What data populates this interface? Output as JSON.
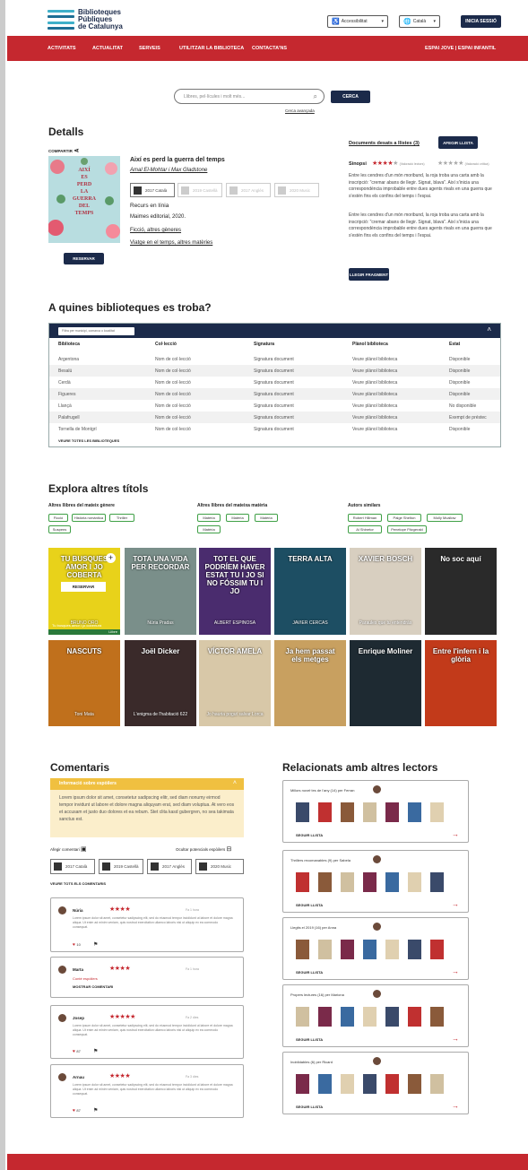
{
  "header": {
    "logo": [
      "Biblioteques",
      "Públiques",
      "de Catalunya"
    ],
    "accessibility": "Accessibilitat",
    "language": "Català",
    "login": "INICIA SESSIÓ",
    "nav": [
      "ACTIVITATS",
      "ACTUALITAT",
      "SERVEIS",
      "UTILITZAR LA BIBLIOTECA",
      "CONTACTA'NS"
    ],
    "nav_right": "ESPAI JOVE | ESPAI INFANTIL"
  },
  "search": {
    "placeholder": "Llibres, pel·lícules i molt més...",
    "button": "CERCA",
    "advanced": "Cerca avançada"
  },
  "details": {
    "heading": "Detalls",
    "share": "COMPARTIR",
    "title": "Així es perd la guerra del temps",
    "authors": "Amal El-Mohtar i Max Gladstone",
    "formats": [
      {
        "year": "2017",
        "lang": "Català"
      },
      {
        "year": "2019",
        "lang": "Castellà"
      },
      {
        "year": "2017",
        "lang": "Anglès"
      },
      {
        "year": "2020",
        "lang": "Music"
      }
    ],
    "online": "Recurs en línia",
    "publisher": "Maimes editorial, 2020.",
    "genre": "Ficció, altres gèneres",
    "subject": "Viatge en el temps, altres matèries",
    "reserve": "RESERVAR",
    "saved_docs": "Documents desats a llistes (3)",
    "add_list": "AFEGIR LLISTA",
    "synopsis_label": "Sinopsi",
    "rating_label": "(Valoració lectors)",
    "rating_label_2": "(Valoració crítica)",
    "synopsis_p1": "Entre les cendres d'un món moribund, la roja troba una carta amb la inscripció: \"cremar abans de llegir. Signat, blava\". Així s'inicia una correspondència improbable entre dues agents rivals en una guerra que s'estén fins els confins del temps i l'espai.",
    "synopsis_p2": "Entre les cendres d'un món moribund, la roja troba una carta amb la inscripció: \"cremar abans de llegir. Signat, blava\". Així s'inicia una correspondència improbable entre dues agents rivals en una guerra que s'estén fins els confins del temps i l'espai.",
    "fragment": "LLEGIR FRAGMENT",
    "cover_lines": [
      "AIXÍ",
      "ES",
      "PERD",
      "LA",
      "GUERRA",
      "DEL",
      "TEMPS"
    ]
  },
  "libraries": {
    "heading": "A quines biblioteques es troba?",
    "filter_placeholder": "Filtra per municipi, comarca o localitat",
    "columns": [
      "Biblioteca",
      "Col·lecció",
      "Signatura",
      "Plànol biblioteca",
      "Estat"
    ],
    "rows": [
      [
        "Argentona",
        "Nom de col·lecció",
        "Signatura document",
        "Veure plànol biblioteca",
        "Disponible"
      ],
      [
        "Besalú",
        "Nom de col·lecció",
        "Signatura document",
        "Veure plànol biblioteca",
        "Disponible"
      ],
      [
        "Cerdà",
        "Nom de col·lecció",
        "Signatura document",
        "Veure plànol biblioteca",
        "Disponible"
      ],
      [
        "Figueres",
        "Nom de col·lecció",
        "Signatura document",
        "Veure plànol biblioteca",
        "Disponible"
      ],
      [
        "Llançà",
        "Nom de col·lecció",
        "Signatura document",
        "Veure plànol biblioteca",
        "No disponible"
      ],
      [
        "Palafrugell",
        "Nom de col·lecció",
        "Signatura document",
        "Veure plànol biblioteca",
        "Exempt de préstec"
      ],
      [
        "Tornella de Montgrí",
        "Nom de col·lecció",
        "Signatura document",
        "Veure plànol biblioteca",
        "Disponible"
      ]
    ],
    "see_all": "VEURE TOTES LES BIBLIOTEQUES"
  },
  "explore": {
    "heading": "Explora altres títols",
    "groups": [
      {
        "title": "Altres llibres del mateix gènere",
        "chips": [
          "Ficció",
          "Història romàntica",
          "Thriller",
          "Suspens"
        ]
      },
      {
        "title": "Altres llibres del mateixa matèria",
        "chips": [
          "Matèria",
          "Matèria",
          "Matèria",
          "Matèria"
        ]
      },
      {
        "title": "Autors similars",
        "chips": [
          "Robert Hillman",
          "Paige Shelton",
          "Molly Mcallow",
          "Al Shinetor",
          "Penelope Fitzgerald"
        ]
      }
    ],
    "books_row1": [
      {
        "title": "TU BUSQUES AMOR I JO COBERTA",
        "author": "BRUNO ORO",
        "subtitle": "Tu busques amor i jo cobertura",
        "bg": "#e8d21a"
      },
      {
        "title": "TOTA UNA VIDA PER RECORDAR",
        "author": "Núria Pradas",
        "bg": "#7a8f8a"
      },
      {
        "title": "TOT EL QUE PODRÍEM HAVER ESTAT TU I JO SI NO FÓSSIM TU I JO",
        "author": "ALBERT ESPINOSA",
        "bg": "#4a2c6e"
      },
      {
        "title": "TERRA ALTA",
        "author": "JAVIER CERCAS",
        "bg": "#1d4e63"
      },
      {
        "title": "XAVIER BOSCH",
        "author": "Paraules que tu entendràs",
        "bg": "#d8cfc0"
      },
      {
        "title": "No soc aquí",
        "author": "",
        "bg": "#2a2a2a"
      }
    ],
    "books_row2": [
      {
        "title": "NASCUTS",
        "author": "Toni Mata",
        "bg": "#c0701c"
      },
      {
        "title": "Joël Dicker",
        "author": "L'enigma de l'habitació 622",
        "bg": "#3a2a2a"
      },
      {
        "title": "VÍCTOR AMELA",
        "author": "Jo hauria pogut salvar Lorca",
        "bg": "#d8c8a8"
      },
      {
        "title": "Ja hem passat els metges",
        "author": "",
        "bg": "#c8a060"
      },
      {
        "title": "Enrique Moliner",
        "author": "",
        "bg": "#1e2a32"
      },
      {
        "title": "Entre l'infern i la glòria",
        "author": "",
        "bg": "#c23a1a"
      }
    ],
    "reserve": "RESERVAR",
    "extra": "Llibre"
  },
  "comments": {
    "heading": "Comentaris",
    "spoiler_title": "Informació sobre espòilers",
    "spoiler_text": "Lorem ipsum dolor sit amet, consetetur sadipscing elitr, sed diam nonumy eirmod tempor invidunt ut labore et dolore magna aliquyam erat, sed diam voluptua. At vero eos et accusam et justo duo dolores et ea rebum. Stet clita kasd gubergren, no sea takimata sanctus est.",
    "add": "Afegir comentari",
    "hide_spoilers": "Ocultar potencials espòilers",
    "see_all": "VEURE TOTS ELS COMENTARIS",
    "items": [
      {
        "name": "Núria",
        "stars": "★★★★",
        "time": "Fa 1 hora",
        "text": "Lorem ipsum dolor sit amet, consetetur sadipscing elit, sed do eiusmod tempor incididunt ut labore et dolore magna aliqua. Ut enim ad minim veniam, quis nostrud exercitation ullamco laboris nisi ut aliquip ex ea commodo consequat.",
        "likes": "10"
      },
      {
        "name": "Marta",
        "stars": "★★★★",
        "time": "Fa 1 hora",
        "spoiler": "Conté espòilers",
        "show": "MOSTRAR COMENTARI"
      },
      {
        "name": "Josep",
        "stars": "★★★★★",
        "time": "Fa 2 dies",
        "text": "Lorem ipsum dolor sit amet, consetetur sadipscing elit, sed do eiusmod tempor incididunt ut labore et dolore magna aliqua. Ut enim ad minim veniam, quis nostrud exercitation ullamco laboris nisi ut aliquip ex ea commodo consequat.",
        "likes": "87"
      },
      {
        "name": "Arnau",
        "stars": "★★★★",
        "time": "Fa 3 dies",
        "text": "Lorem ipsum dolor sit amet, consetetur sadipscing elit, sed do eiusmod tempor incididunt ut labore et dolore magna aliqua. Ut enim ad minim veniam, quis nostrud exercitation ullamco laboris nisi ut aliquip ex ea commodo consequat.",
        "likes": "87"
      }
    ]
  },
  "related": {
    "heading": "Relacionats amb altres lectors",
    "follow": "SEGUIR LLISTA",
    "lists": [
      "Millors novel·les de l'any (14) per Ferran",
      "Thrillers recomanables (9) per Sabela",
      "Llegits el 2019 (16) per Anna",
      "Propers lectures (16) per Mariona",
      "Inoblidables (6) per Ricard"
    ]
  },
  "colors": {
    "brand_red": "#c5282f",
    "navy": "#1b2a4a",
    "spoiler_yellow": "#f0c040"
  }
}
